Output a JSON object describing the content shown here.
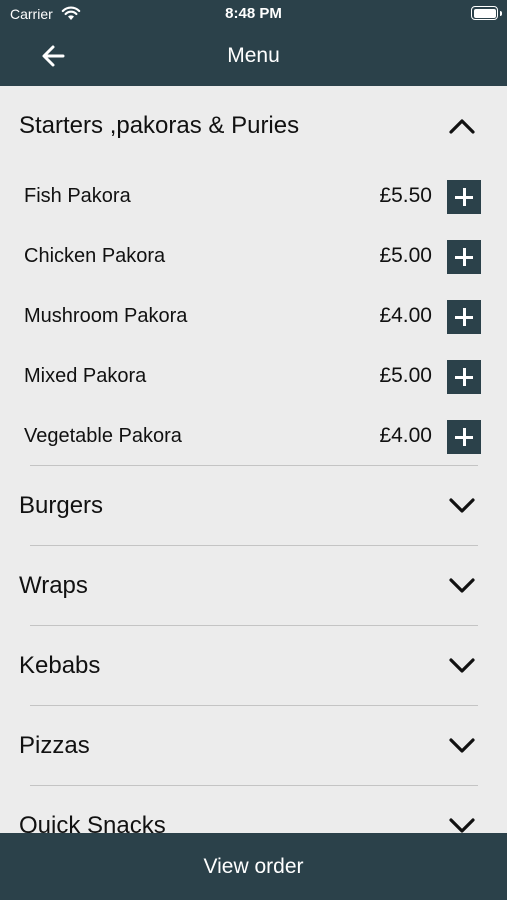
{
  "status_bar": {
    "carrier": "Carrier",
    "time": "8:48 PM"
  },
  "header": {
    "title": "Menu",
    "back_icon": "arrow-left-icon"
  },
  "sections": [
    {
      "title": "Starters ,pakoras & Puries",
      "expanded": true,
      "items": [
        {
          "name": "Fish Pakora",
          "price": "£5.50"
        },
        {
          "name": "Chicken Pakora",
          "price": "£5.00"
        },
        {
          "name": "Mushroom Pakora",
          "price": "£4.00"
        },
        {
          "name": "Mixed Pakora",
          "price": "£5.00"
        },
        {
          "name": "Vegetable Pakora",
          "price": "£4.00"
        }
      ]
    },
    {
      "title": "Burgers",
      "expanded": false
    },
    {
      "title": "Wraps",
      "expanded": false
    },
    {
      "title": "Kebabs",
      "expanded": false
    },
    {
      "title": "Pizzas",
      "expanded": false
    },
    {
      "title": "Quick Snacks",
      "expanded": false
    }
  ],
  "footer": {
    "view_order_label": "View order"
  },
  "colors": {
    "primary": "#2b414a",
    "background": "#ececec",
    "text": "#111111"
  }
}
